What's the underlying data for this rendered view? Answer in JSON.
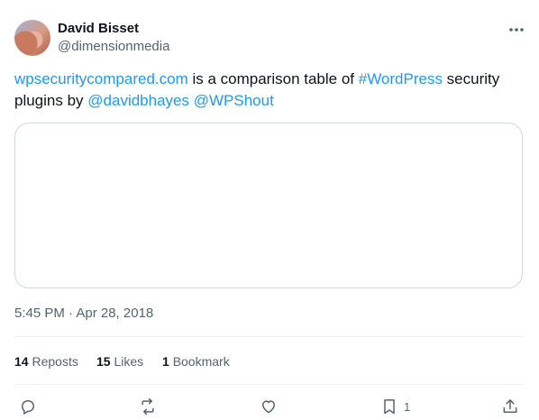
{
  "author": {
    "name": "David Bisset",
    "handle": "@dimensionmedia"
  },
  "tweet": {
    "link_site": "wpsecuritycompared.com",
    "text_1": " is a  comparison table of ",
    "hashtag": "#WordPress",
    "text_2": " security plugins by ",
    "mention_1": "@davidbhayes",
    "mention_2": "@WPShout",
    "timestamp": "5:45 PM · Apr 28, 2018"
  },
  "stats": {
    "reposts_count": "14",
    "reposts_label": "Reposts",
    "likes_count": "15",
    "likes_label": "Likes",
    "bookmarks_count": "1",
    "bookmarks_label": "Bookmark"
  },
  "actions": {
    "bookmark_count": "1"
  },
  "colors": {
    "link": "#1d9bf0",
    "text": "#0f1419",
    "muted": "#536471",
    "border": "#cfd9de"
  },
  "icons": [
    "more-icon",
    "reply-icon",
    "repost-icon",
    "like-icon",
    "bookmark-icon",
    "share-icon"
  ]
}
